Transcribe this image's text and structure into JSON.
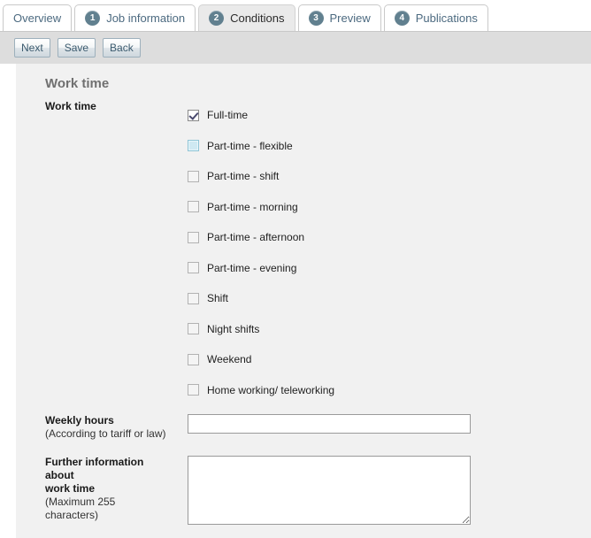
{
  "tabs": [
    {
      "num": "",
      "label": "Overview",
      "active": false
    },
    {
      "num": "1",
      "label": "Job information",
      "active": false
    },
    {
      "num": "2",
      "label": "Conditions",
      "active": true
    },
    {
      "num": "3",
      "label": "Preview",
      "active": false
    },
    {
      "num": "4",
      "label": "Publications",
      "active": false
    }
  ],
  "toolbar": {
    "next_label": "Next",
    "save_label": "Save",
    "back_label": "Back"
  },
  "section": {
    "title": "Work time"
  },
  "work_time": {
    "label": "Work time",
    "options": [
      {
        "label": "Full-time",
        "checked": true,
        "hovered": false
      },
      {
        "label": "Part-time - flexible",
        "checked": false,
        "hovered": true
      },
      {
        "label": "Part-time - shift",
        "checked": false,
        "hovered": false
      },
      {
        "label": "Part-time - morning",
        "checked": false,
        "hovered": false
      },
      {
        "label": "Part-time - afternoon",
        "checked": false,
        "hovered": false
      },
      {
        "label": "Part-time - evening",
        "checked": false,
        "hovered": false
      },
      {
        "label": "Shift",
        "checked": false,
        "hovered": false
      },
      {
        "label": "Night shifts",
        "checked": false,
        "hovered": false
      },
      {
        "label": "Weekend",
        "checked": false,
        "hovered": false
      },
      {
        "label": "Home working/ teleworking",
        "checked": false,
        "hovered": false
      }
    ]
  },
  "weekly_hours": {
    "label": "Weekly hours",
    "sub_label": "(According to tariff or law)",
    "value": "",
    "placeholder": ""
  },
  "further_info": {
    "label_line1": "Further information about",
    "label_line2": "work time",
    "sub_line1": "(Maximum 255",
    "sub_line2": "characters)",
    "value": "",
    "placeholder": ""
  },
  "colors": {
    "tab_number_badge": "#61808f",
    "active_tab_bg": "#eaeaea",
    "toolbar_bg": "#dddddd",
    "page_bg": "#f1f1f1",
    "section_title": "#707070",
    "checkbox_hover": "#cfe9f2"
  }
}
